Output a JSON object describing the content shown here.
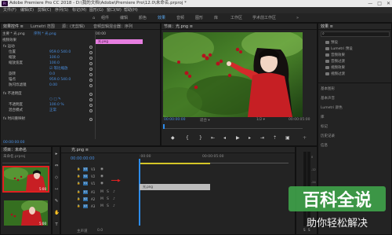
{
  "titlebar": {
    "app_badge": "Pr",
    "title": "Adobe Premiere Pro CC 2018 - D:\\我的文档\\Adobe\\Premiere Pro\\12.0\\未命名.prproj *",
    "minimize": "—",
    "maximize": "□",
    "close": "✕"
  },
  "menu": [
    "文件(F)",
    "编辑(E)",
    "剪辑(C)",
    "序列(S)",
    "标记(M)",
    "图形(G)",
    "窗口(W)",
    "帮助(H)"
  ],
  "workspaces": {
    "home_icon": "⌂",
    "items": [
      "组件",
      "编辑",
      "颜色",
      "效果",
      "音频",
      "图形",
      "库",
      "工作区",
      "学术前工作区"
    ],
    "active_index": 3,
    "more": "»"
  },
  "effect_controls": {
    "tabs": [
      "效果控件 ≡",
      "Lumetri 范围",
      "源：(无剪辑)",
      "音频剪辑混合器：序列"
    ],
    "source": "主要 * 光.png",
    "sequence": "序列 * 光.png",
    "timecode_start": "00:00",
    "clip_label": "光.png",
    "section_video": "视频效果",
    "rows": [
      {
        "label": "fx 运动"
      },
      {
        "label": "位置",
        "value": "959.0   540.0"
      },
      {
        "label": "缩放",
        "value": "100.0"
      },
      {
        "label": "缩放宽度",
        "value": "100.0"
      },
      {
        "label": "",
        "value": "☑ 等比缩放"
      },
      {
        "label": "旋转",
        "value": "0.0"
      },
      {
        "label": "锚点",
        "value": "959.0   540.0"
      },
      {
        "label": "防闪烁滤镜",
        "value": "0.00"
      },
      {
        "label": "fx 不透明度"
      },
      {
        "label": "",
        "value": "○ □ ✎"
      },
      {
        "label": "不透明度",
        "value": "100.0 %"
      },
      {
        "label": "混合模式",
        "value": "正常"
      },
      {
        "label": "fx 时间重映射"
      }
    ],
    "timecode": "00:00:00:00"
  },
  "program": {
    "tab": "节目：光.png ≡",
    "timecode": "00:00:00:00",
    "fit": "适合",
    "quality": "1/2",
    "duration": "00:00:05:00"
  },
  "right_panel": {
    "tab": "效果 ≡",
    "search": "⌕",
    "tree": [
      "预设",
      "Lumetri 预设",
      "音频效果",
      "音频过渡",
      "视频效果",
      "视频过渡"
    ],
    "sections": [
      "基本图形",
      "基本声音",
      "Lumetri 颜色",
      "库",
      "标记",
      "历史记录",
      "信息"
    ]
  },
  "project": {
    "tab": "项目：未命名",
    "file": "未命名.prproj",
    "clip1_dur": "5:00",
    "clip2_dur": "5:00"
  },
  "tools": [
    "▸",
    "⇔",
    "◇",
    "⇿",
    "✎",
    "✋",
    "T"
  ],
  "timeline": {
    "tab": "光.png ≡",
    "timecode": "00:00:00:00",
    "ruler_start": ":00:00",
    "ruler_end": "00:00:05:00",
    "tracks": [
      "V3",
      "V2",
      "V1",
      "A1",
      "A2",
      "A3"
    ],
    "master": "主声道",
    "master_value": "0.0",
    "clip_label": "光.png"
  },
  "meter": {
    "labels": [
      "0",
      "-12",
      "-24",
      "-36",
      "-48",
      "dB"
    ],
    "solo": "S",
    "solo2": "S"
  },
  "watermark": {
    "line1": "百科全说",
    "line2": "助你轻松解决"
  }
}
